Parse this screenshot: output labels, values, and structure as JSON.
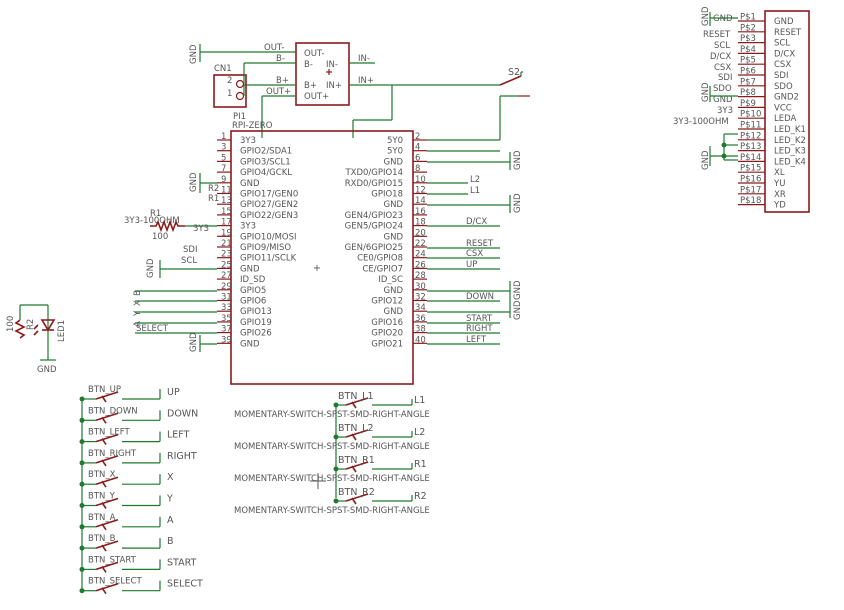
{
  "display": {
    "pins": [
      "GND",
      "RESET",
      "SCL",
      "D/CX",
      "CSX",
      "SDI",
      "SDO",
      "GND2",
      "VCC",
      "LEDA",
      "LED_K1",
      "LED_K2",
      "LED_K3",
      "LED_K4",
      "XL",
      "YU",
      "XR",
      "YD"
    ],
    "pin_nums": [
      "P$1",
      "P$2",
      "P$3",
      "P$4",
      "P$5",
      "P$6",
      "P$7",
      "P$8",
      "P$9",
      "P$10",
      "P$11",
      "P$12",
      "P$13",
      "P$14",
      "P$15",
      "P$16",
      "P$17",
      "P$18"
    ],
    "nets": [
      "GND",
      "RESET",
      "SCL",
      "D/CX",
      "CSX",
      "SDI",
      "SDO",
      "GND",
      "3Y3",
      "3Y3-100OHM"
    ],
    "gnd": "GND"
  },
  "pi": {
    "name": "PI1",
    "value": "RPI-ZERO",
    "left_pins": [
      "3Y3",
      "GPIO2/SDA1",
      "GPIO3/SCL1",
      "GPIO4/GCKL",
      "GND",
      "GPIO17/GEN0",
      "GPIO27/GEN2",
      "GPIO22/GEN3",
      "3Y3",
      "GPIO10/MOSI",
      "GPIO9/MISO",
      "GPIO11/SCLK",
      "GND",
      "ID_SD",
      "GPIO5",
      "GPIO6",
      "GPIO13",
      "GPIO19",
      "GPIO26",
      "GND"
    ],
    "left_nums": [
      "1",
      "3",
      "5",
      "7",
      "9",
      "11",
      "13",
      "15",
      "17",
      "19",
      "21",
      "23",
      "25",
      "27",
      "29",
      "31",
      "33",
      "35",
      "37",
      "39"
    ],
    "right_pins": [
      "5Y0",
      "5Y0",
      "GND",
      "TXD0/GPIO14",
      "RXD0/GPIO15",
      "GPIO18",
      "GND",
      "GEN4/GPIO23",
      "GEN5/GPIO24",
      "GND",
      "GEN/6GPIO25",
      "CE0/GPIO8",
      "CE/GPIO7",
      "ID_SC",
      "GND",
      "GPIO12",
      "GND",
      "GPIO16",
      "GPIO20",
      "GPIO21"
    ],
    "right_nums": [
      "2",
      "4",
      "6",
      "8",
      "10",
      "12",
      "14",
      "16",
      "18",
      "20",
      "22",
      "24",
      "26",
      "28",
      "30",
      "32",
      "34",
      "36",
      "38",
      "40"
    ],
    "left_nets": [
      "R2",
      "R1",
      "3Y3",
      "SDI",
      "SCL",
      "B",
      "X",
      "Y",
      "A",
      "SELECT"
    ],
    "right_nets": [
      "L2",
      "L1",
      "D/CX",
      "RESET",
      "CSX",
      "UP",
      "DOWN",
      "START",
      "RIGHT",
      "LEFT"
    ],
    "gnd_labels": [
      "GND",
      "GND",
      "GND",
      "GND",
      "GND",
      "GND",
      "GND"
    ]
  },
  "resistor1": {
    "name": "R1",
    "value": "100",
    "net": "3Y3-100OHM"
  },
  "led": {
    "name": "LED1",
    "resistor_name": "R2",
    "resistor_value": "100",
    "gnd": "GND"
  },
  "connector": {
    "name": "CN1",
    "pins": [
      "2",
      "1"
    ]
  },
  "power_module": {
    "pins_left": [
      "OUT-",
      "B-",
      "B+",
      "OUT+"
    ],
    "pins_right": [
      "IN-",
      "IN+"
    ],
    "net_labels": [
      "OUT-",
      "B-",
      "B+",
      "OUT+",
      "IN-",
      "IN+"
    ],
    "gnd": "GND"
  },
  "switch_s2": {
    "name": "S2"
  },
  "buttons_left": [
    {
      "name": "BTN_UP",
      "net": "UP"
    },
    {
      "name": "BTN_DOWN",
      "net": "DOWN"
    },
    {
      "name": "BTN_LEFT",
      "net": "LEFT"
    },
    {
      "name": "BTN_RIGHT",
      "net": "RIGHT"
    },
    {
      "name": "BTN_X",
      "net": "X"
    },
    {
      "name": "BTN_Y",
      "net": "Y"
    },
    {
      "name": "BTN_A",
      "net": "A"
    },
    {
      "name": "BTN_B",
      "net": "B"
    },
    {
      "name": "BTN_START",
      "net": "START"
    },
    {
      "name": "BTN_SELECT",
      "net": "SELECT"
    }
  ],
  "buttons_shoulder": [
    {
      "name": "BTN_L1",
      "net": "L1"
    },
    {
      "name": "BTN_L2",
      "net": "L2"
    },
    {
      "name": "BTN_R1",
      "net": "R1"
    },
    {
      "name": "BTN_R2",
      "net": "R2"
    }
  ],
  "switch_value": "MOMENTARY-SWITCH-SPST-SMD-RIGHT-ANGLE"
}
